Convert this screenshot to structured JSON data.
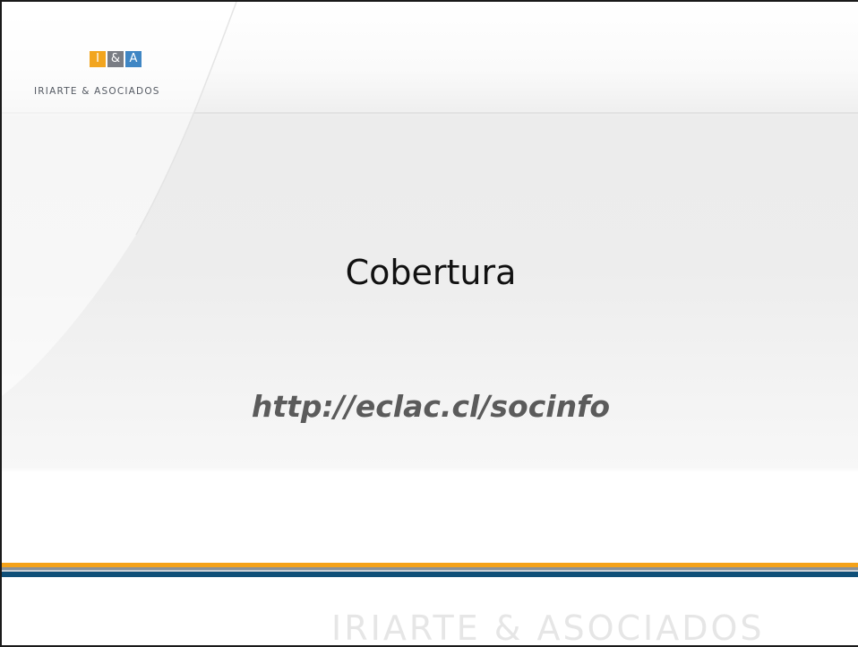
{
  "logo": {
    "marks": [
      "I",
      "&",
      "A"
    ],
    "name": "IRIARTE & ASOCIADOS"
  },
  "slide": {
    "title": "Cobertura",
    "link": "http://eclac.cl/socinfo"
  },
  "footer": {
    "watermark": "IRIARTE & ASOCIADOS"
  },
  "colors": {
    "orange": "#f2a51f",
    "gray": "#7a7d84",
    "blue": "#3f86c4",
    "navy": "#0f4f78"
  }
}
